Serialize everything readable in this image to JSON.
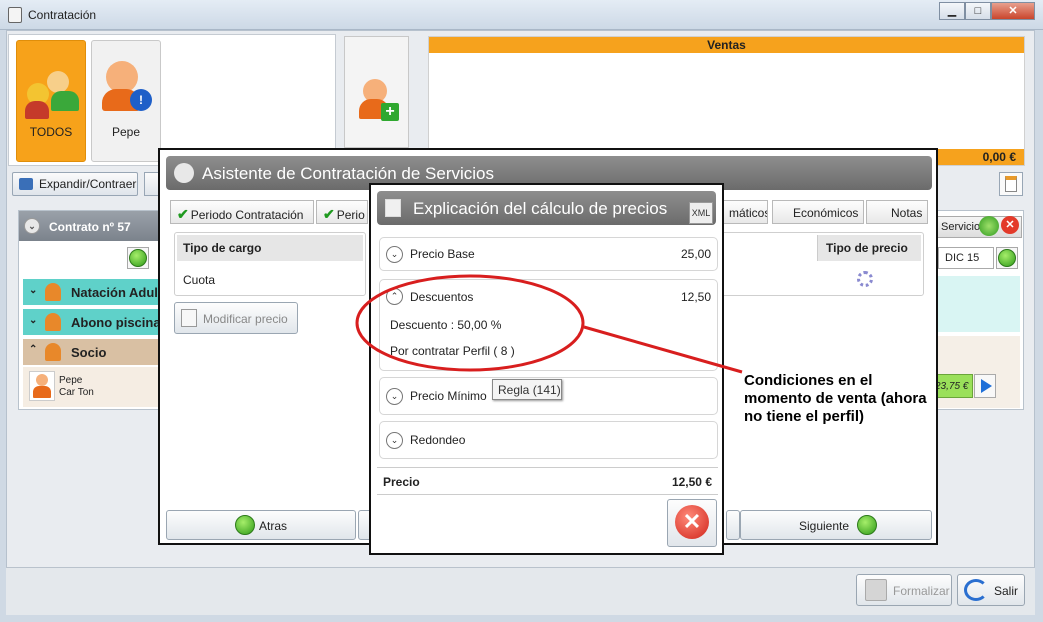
{
  "window": {
    "title": "Contratación",
    "minimize": "▁",
    "maximize": "□",
    "close": "✕"
  },
  "tiles": [
    {
      "label": "TODOS"
    },
    {
      "label": "Pepe"
    }
  ],
  "ventas": {
    "title": "Ventas",
    "total": "0,00 €"
  },
  "toolbar": {
    "expand_label": "Expandir/Contraer"
  },
  "contract": {
    "title": "Contrato nº 57",
    "rows": [
      {
        "label": "Natación Adultos"
      },
      {
        "label": "Abono piscina m"
      },
      {
        "label": "Socio"
      }
    ],
    "member": {
      "name": "Pepe",
      "surname": "Car Ton"
    },
    "right_button": "Servicio...",
    "month": "DIC 15",
    "amount": "23,75 €"
  },
  "wizard": {
    "title": "Asistente de Contratación de Servicios",
    "tabs": [
      "Periodo Contratación",
      "Perio",
      "máticos",
      "Económicos",
      "Notas"
    ],
    "table": {
      "col_left": "Tipo de cargo",
      "cell_left": "Cuota",
      "col_right": "Tipo de precio"
    },
    "modify_price": "Modificar precio",
    "back": "Atras",
    "next": "Siguiente"
  },
  "popup": {
    "title": "Explicación del cálculo de precios",
    "xml": "XML",
    "base_label": "Precio Base",
    "base_value": "25,00",
    "disc_label": "Descuentos",
    "disc_value": "12,50",
    "disc_detail": "Descuento : 50,00 %",
    "disc_reason": "Por contratar  Perfil ( 8 )",
    "min_label": "Precio Mínimo",
    "round_label": "Redondeo",
    "price_label": "Precio",
    "price_value": "12,50 €"
  },
  "tooltip": "Regla (141)",
  "annotation": "Condiciones en el momento de venta (ahora no tiene el perfil)",
  "footer": {
    "formalize": "Formalizar",
    "exit": "Salir"
  },
  "colors": {
    "accent_orange": "#f6a21d",
    "teal": "#5fd1c9",
    "annotation_red": "#d81e1e"
  }
}
